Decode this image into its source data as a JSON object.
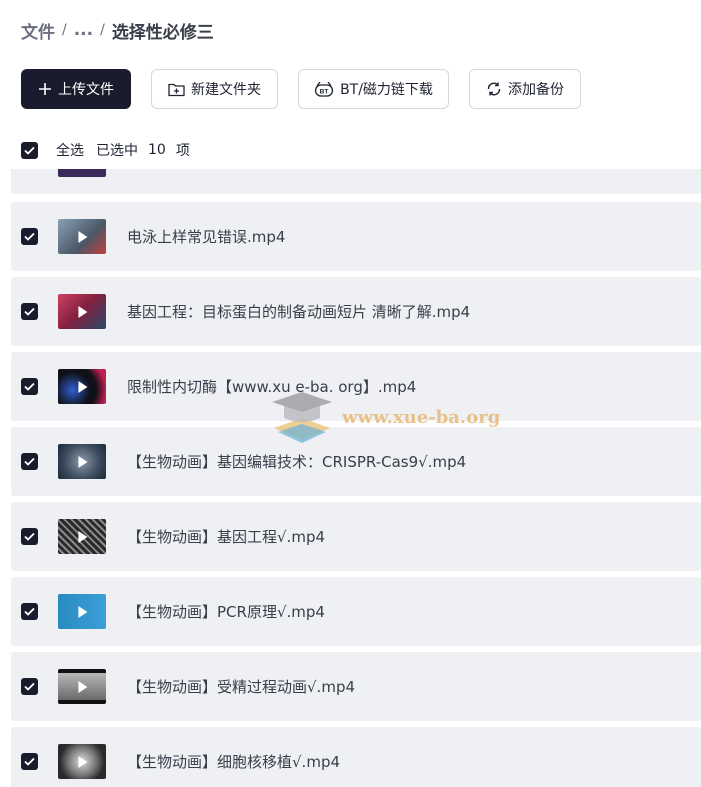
{
  "breadcrumb": {
    "root": "文件",
    "ellipsis": "...",
    "current": "选择性必修三"
  },
  "toolbar": {
    "upload_label": "上传文件",
    "new_folder_label": "新建文件夹",
    "bt_label": "BT/磁力链下载",
    "backup_label": "添加备份"
  },
  "selection": {
    "select_all_label": "全选",
    "selected_prefix": "已选中",
    "selected_count": "10",
    "selected_suffix": "项",
    "checked": true
  },
  "files": [
    {
      "name": "",
      "thumb_color": "#3a2a5a",
      "checked": true
    },
    {
      "name": "电泳上样常见错误.mp4",
      "thumb_color": "#5a6a7a",
      "checked": true
    },
    {
      "name": "基因工程：目标蛋白的制备动画短片  清晰了解.mp4",
      "thumb_color": "#b03050",
      "checked": true
    },
    {
      "name": "限制性内切酶【www.xu e-ba. org】.mp4",
      "thumb_color": "#101018",
      "checked": true
    },
    {
      "name": "【生物动画】基因编辑技术：CRISPR-Cas9√.mp4",
      "thumb_color": "#4a5a6a",
      "checked": true
    },
    {
      "name": "【生物动画】基因工程√.mp4",
      "thumb_color": "#3a3a3a",
      "checked": true
    },
    {
      "name": "【生物动画】PCR原理√.mp4",
      "thumb_color": "#2a8ac0",
      "checked": true
    },
    {
      "name": "【生物动画】受精过程动画√.mp4",
      "thumb_color": "#9a9a9a",
      "checked": true
    },
    {
      "name": "【生物动画】细胞核移植√.mp4",
      "thumb_color": "#6a6a6a",
      "checked": true
    }
  ],
  "watermark": {
    "text": "www.xue-ba.org"
  }
}
